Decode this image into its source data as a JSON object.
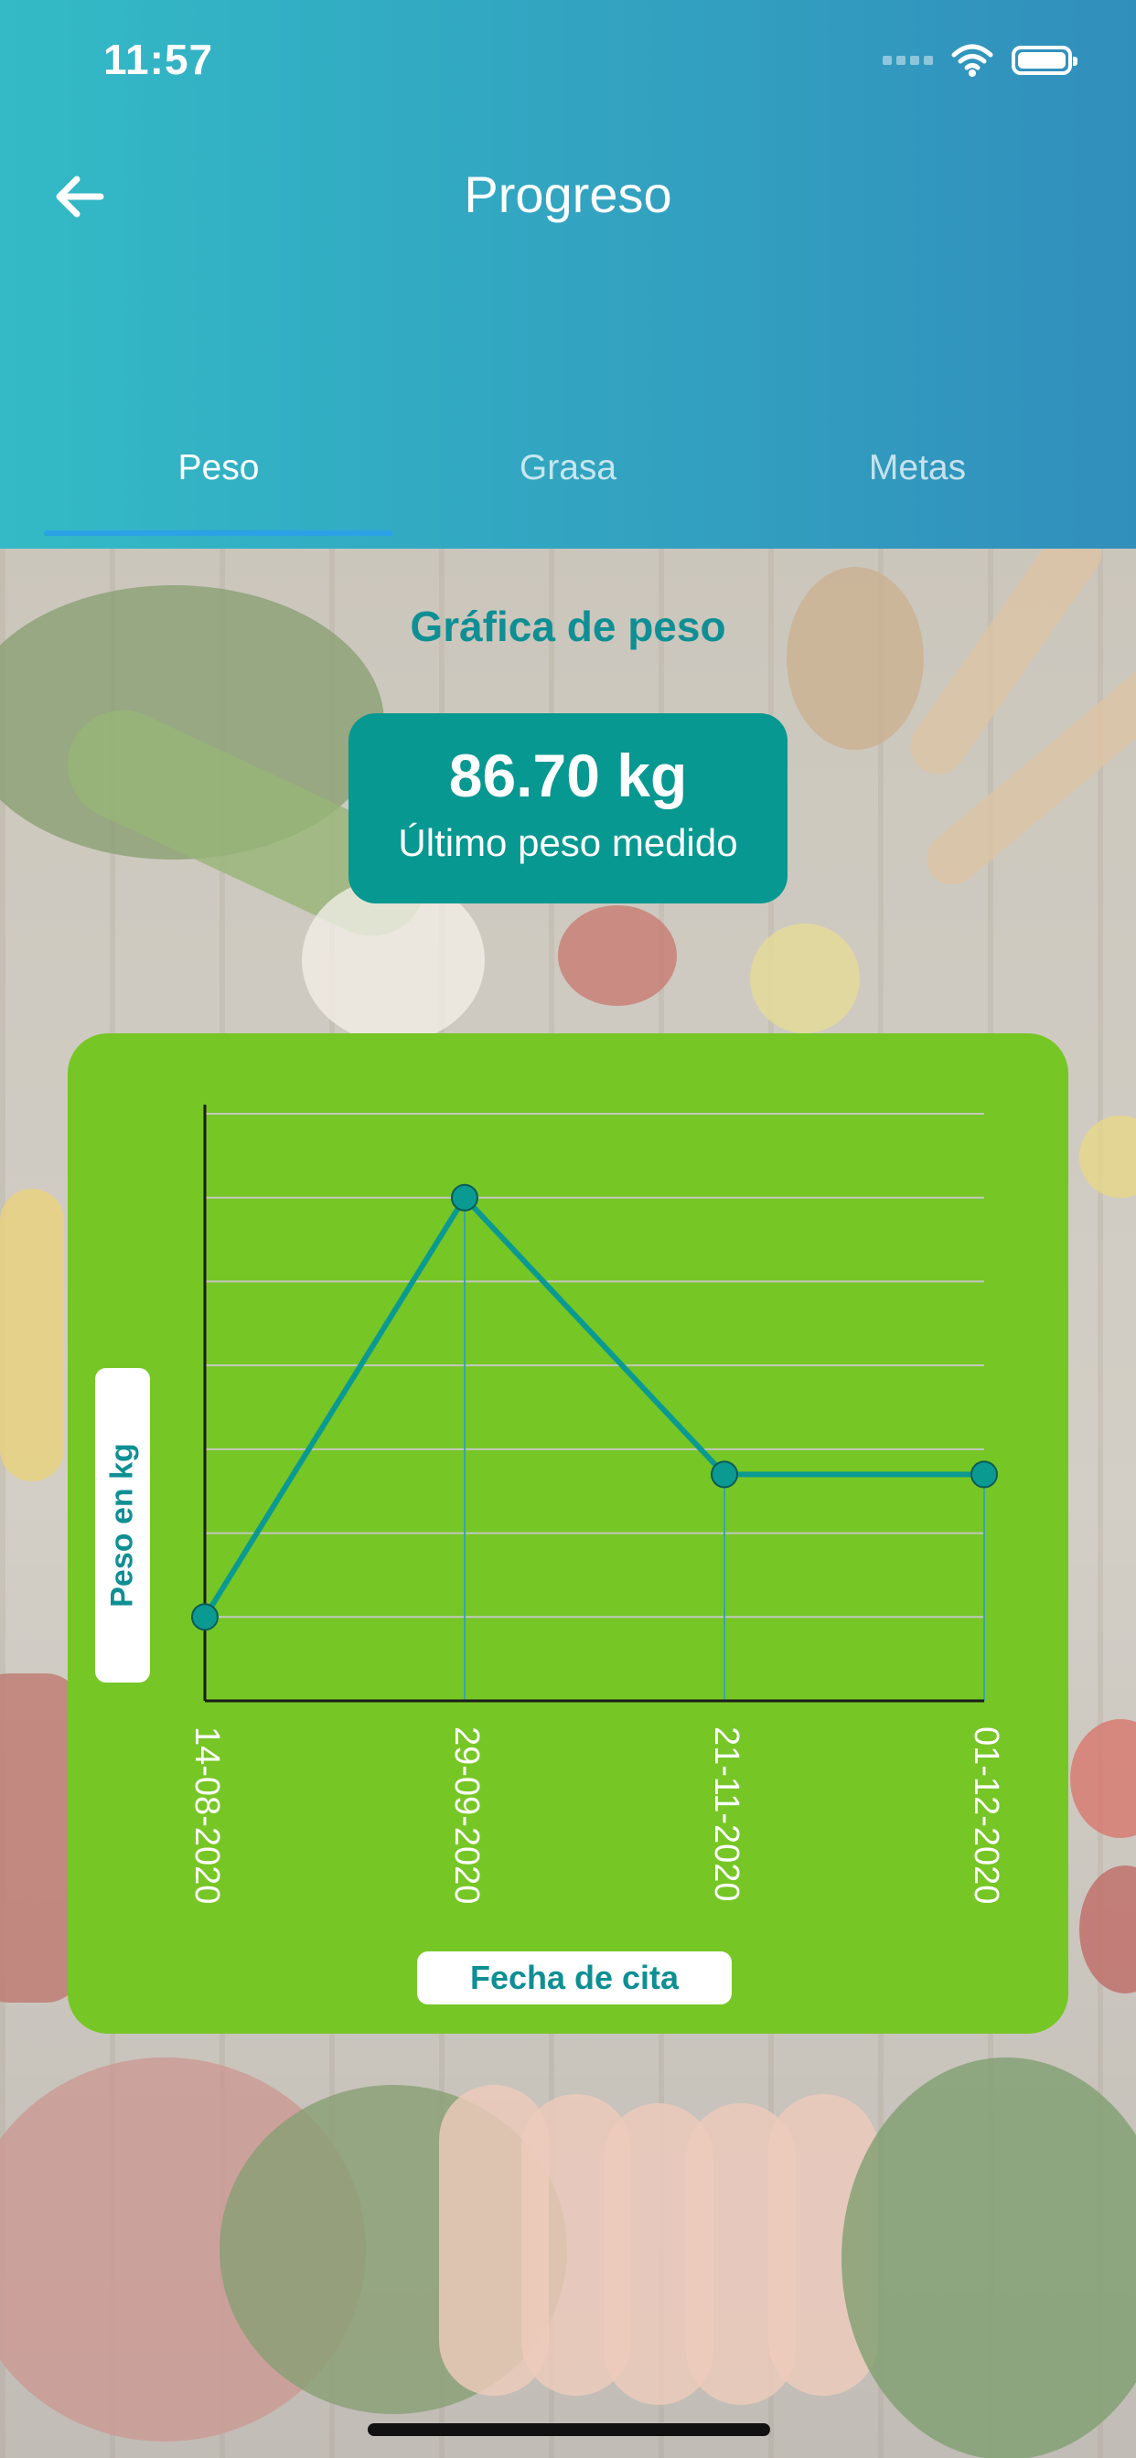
{
  "status_bar": {
    "time": "11:57"
  },
  "header": {
    "title": "Progreso",
    "back_icon": "arrow-left-icon"
  },
  "tabs": [
    {
      "label": "Peso",
      "active": true
    },
    {
      "label": "Grasa",
      "active": false
    },
    {
      "label": "Metas",
      "active": false
    }
  ],
  "section": {
    "title": "Gráfica de peso"
  },
  "latest": {
    "value": "86.70 kg",
    "label": "Último peso medido"
  },
  "chart_data": {
    "type": "line",
    "x": [
      "14-08-2020",
      "29-09-2020",
      "21-11-2020",
      "01-12-2020"
    ],
    "values": [
      1,
      6,
      2.7,
      2.7
    ],
    "ylabel": "Peso en kg",
    "xlabel": "Fecha de cita",
    "ylim": [
      0,
      7
    ],
    "grid": true,
    "colors": {
      "line": "#0b9a91",
      "point": "#0b9a91",
      "background": "#76c626",
      "grid": "#c3c7bd",
      "axis": "#1b1b1b"
    }
  }
}
